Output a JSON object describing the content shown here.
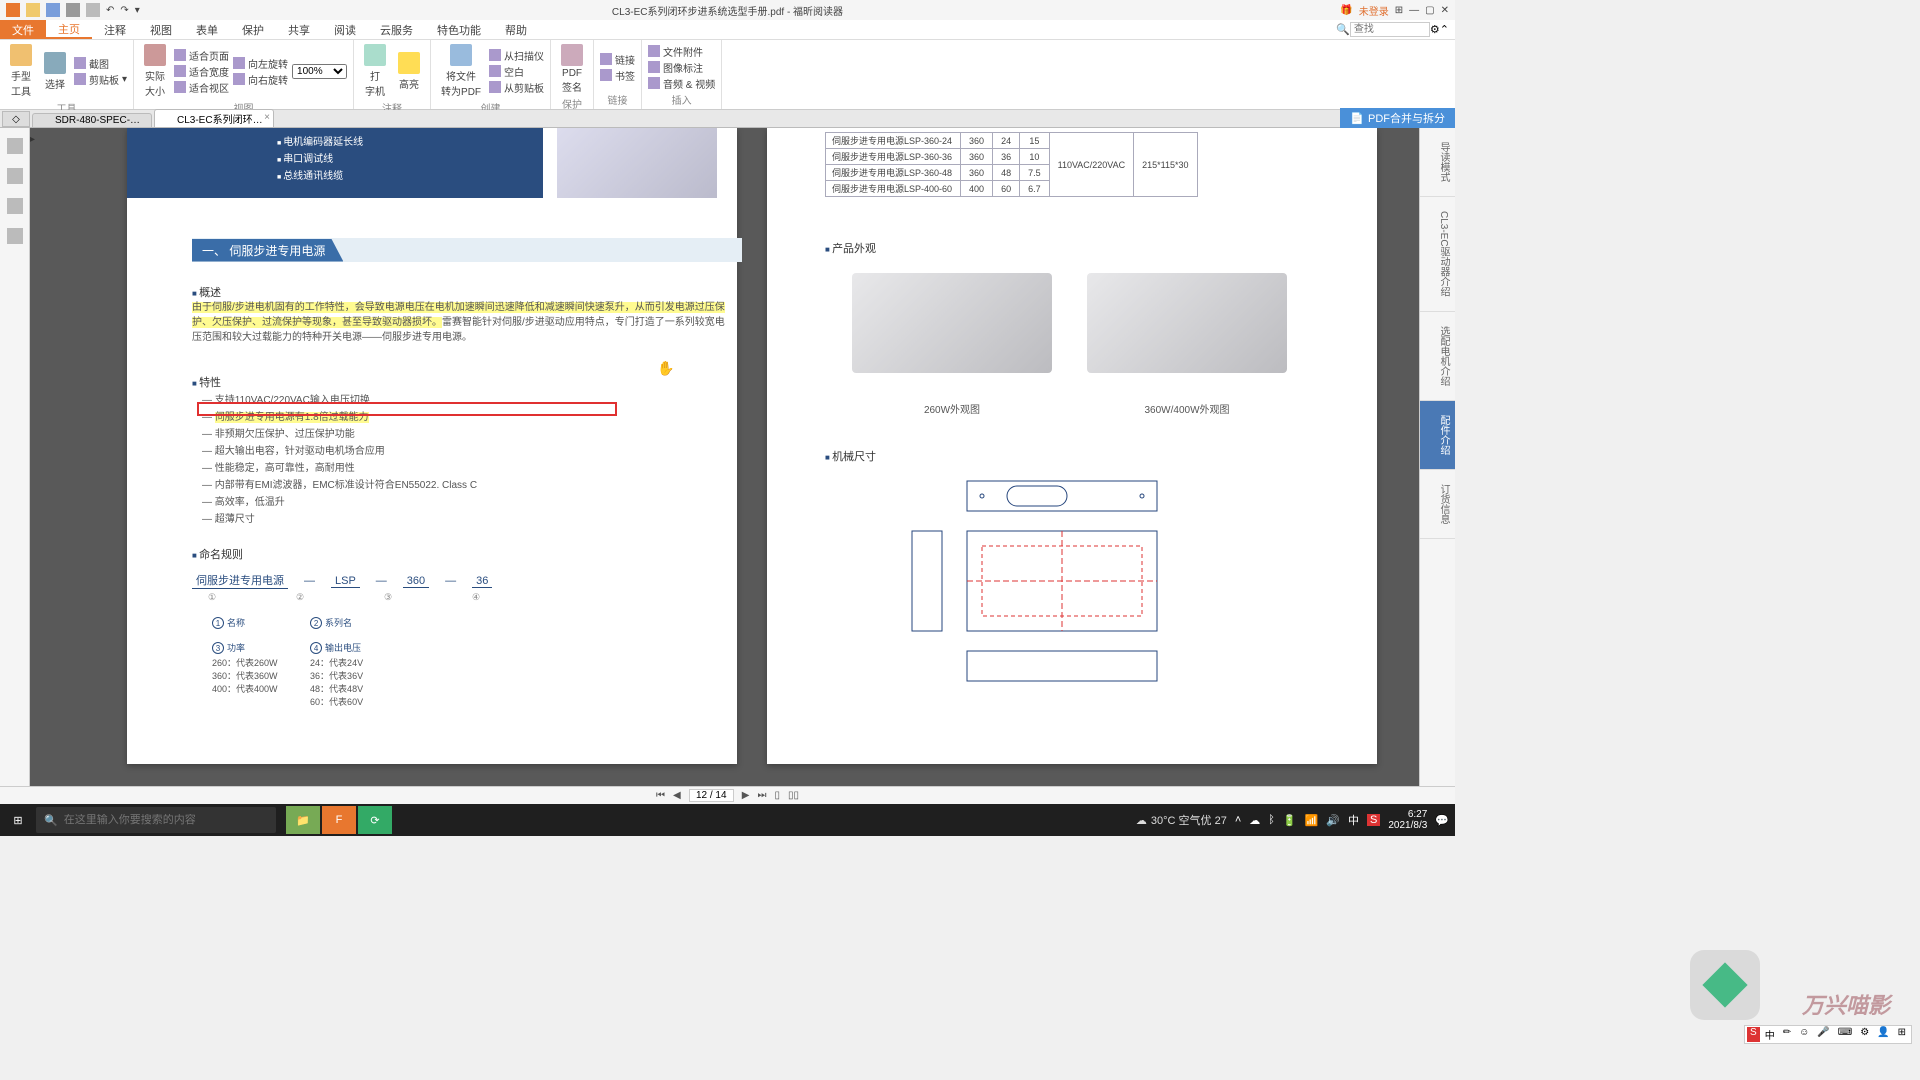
{
  "titlebar": {
    "title": "CL3-EC系列闭环步进系统选型手册.pdf - 福昕阅读器",
    "login": "未登录"
  },
  "menu": {
    "file": "文件",
    "home": "主页",
    "annotate": "注释",
    "view": "视图",
    "forms": "表单",
    "protect": "保护",
    "share": "共享",
    "read": "阅读",
    "cloud": "云服务",
    "special": "特色功能",
    "help": "帮助",
    "search_placeholder": "查找"
  },
  "ribbon": {
    "tools_group": "工具",
    "hand": "手型\n工具",
    "select": "选择",
    "snapshot": "截图",
    "clipboard": "剪贴板",
    "view_group": "视图",
    "actual": "实际\n大小",
    "fit_page": "适合页面",
    "fit_width": "适合宽度",
    "fit_visible": "适合视区",
    "rotate_l": "向左旋转",
    "rotate_r": "向右旋转",
    "zoom": "100%",
    "annotate_group": "注释",
    "typewriter": "打\n字机",
    "highlight": "高亮",
    "create_group": "创建",
    "to_pdf": "将文件\n转为PDF",
    "from_scan": "从扫描仪",
    "blank": "空白",
    "from_clip": "从剪贴板",
    "protect_group": "保护",
    "pdf_sign": "PDF\n签名",
    "links_group": "链接",
    "link": "链接",
    "bookmark": "书签",
    "insert_group": "插入",
    "attach": "文件附件",
    "img_annot": "图像标注",
    "av": "音频 & 视频"
  },
  "doctabs": {
    "tab1": "SDR-480-SPEC-CN....",
    "tab2": "CL3-EC系列闭环步进...",
    "merge": "PDF合并与拆分"
  },
  "right_rail": {
    "t1": "导读模式",
    "t2": "CL3-EC驱动器介绍",
    "t3": "选配电机介绍",
    "t4": "配件介绍",
    "t5": "订货信息"
  },
  "status": {
    "page": "12 / 14"
  },
  "taskbar": {
    "search_placeholder": "在这里输入你要搜索的内容",
    "weather": "30°C 空气优 27",
    "time": "6:27",
    "date": "2021/8/3"
  },
  "pdf_left": {
    "bullets": [
      "电机编码器延长线",
      "串口调试线",
      "总线通讯线缆"
    ],
    "section_num": "一、",
    "section_title": "伺服步进专用电源",
    "overview_h": "概述",
    "overview": {
      "hl": "由于伺服/步进电机固有的工作特性，会导致电源电压在电机加速瞬间迅速降低和减速瞬间快速泵升，从而引发电源过压保护、欠压保护、过流保护等现象，甚至导致驱动器损坏。",
      "rest": "雷赛智能针对伺服/步进驱动应用特点，专门打造了一系列较宽电压范围和较大过载能力的特种开关电源——伺服步进专用电源。"
    },
    "features_h": "特性",
    "features": [
      "支持110VAC/220VAC输入电压切换",
      "伺服步进专用电源有1.8倍过载能力",
      "非预期欠压保护、过压保护功能",
      "超大输出电容，针对驱动电机场合应用",
      "性能稳定，高可靠性，高耐用性",
      "内部带有EMI滤波器，EMC标准设计符合EN55022. Class C",
      "高效率，低温升",
      "超薄尺寸"
    ],
    "naming_h": "命名规则",
    "naming_terms": [
      "伺服步进专用电源",
      "LSP",
      "360",
      "36"
    ],
    "circles": [
      "①",
      "②",
      "③",
      "④"
    ],
    "col1_h": "名称",
    "col2_h": "系列名",
    "col3_h": "功率",
    "col3": [
      "260：代表260W",
      "360：代表360W",
      "400：代表400W"
    ],
    "col4_h": "输出电压",
    "col4": [
      "24：代表24V",
      "36：代表36V",
      "48：代表48V",
      "60：代表60V"
    ]
  },
  "pdf_right": {
    "table": [
      [
        "伺服步进专用电源LSP-360-24",
        "360",
        "24",
        "15"
      ],
      [
        "伺服步进专用电源LSP-360-36",
        "360",
        "36",
        "10"
      ],
      [
        "伺服步进专用电源LSP-360-48",
        "360",
        "48",
        "7.5"
      ],
      [
        "伺服步进专用电源LSP-400-60",
        "400",
        "60",
        "6.7"
      ]
    ],
    "voltage": "110VAC/220VAC",
    "size": "215*115*30",
    "appearance_h": "产品外观",
    "img1_label": "260W外观图",
    "img2_label": "360W/400W外观图",
    "mech_h": "机械尺寸"
  },
  "watermark": "万兴喵影"
}
